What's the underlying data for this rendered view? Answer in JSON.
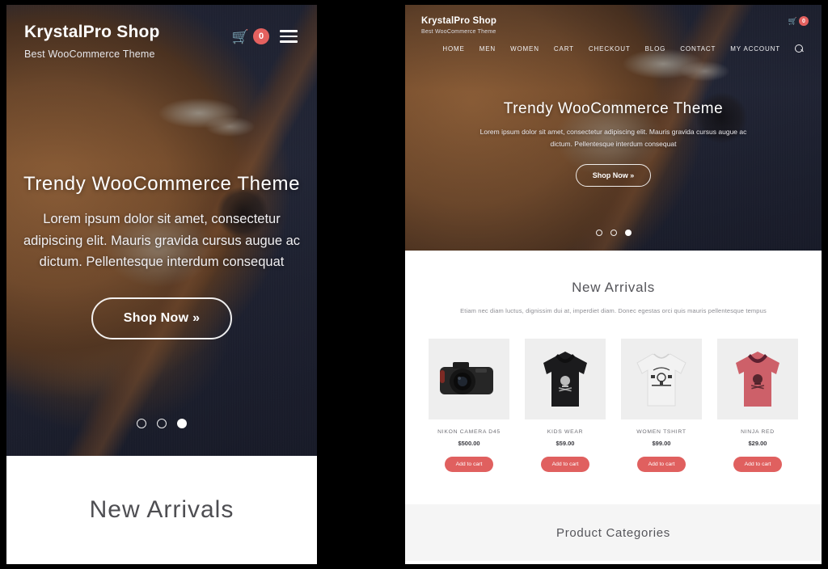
{
  "brand": {
    "title": "KrystalPro Shop",
    "tagline": "Best WooCommerce Theme"
  },
  "cart": {
    "count": "0",
    "icon": "shopping-cart-icon"
  },
  "mobile": {
    "menu_icon": "hamburger-menu-icon",
    "hero": {
      "heading": "Trendy WooCommerce Theme",
      "paragraph": "Lorem ipsum dolor sit amet, consectetur adipiscing elit. Mauris gravida cursus augue ac dictum. Pellentesque interdum consequat",
      "cta": "Shop Now »",
      "slides": [
        "1",
        "2",
        "3"
      ],
      "active_slide": 3
    },
    "arrivals_title": "New Arrivals"
  },
  "desktop": {
    "nav": [
      {
        "label": "HOME"
      },
      {
        "label": "MEN"
      },
      {
        "label": "WOMEN"
      },
      {
        "label": "CART"
      },
      {
        "label": "CHECKOUT"
      },
      {
        "label": "BLOG"
      },
      {
        "label": "CONTACT"
      },
      {
        "label": "MY ACCOUNT"
      }
    ],
    "search_icon": "search-icon",
    "hero": {
      "heading": "Trendy WooCommerce Theme",
      "paragraph": "Lorem ipsum dolor sit amet, consectetur adipiscing elit. Mauris gravida cursus augue ac dictum. Pellentesque interdum consequat",
      "cta": "Shop Now »",
      "slides": [
        "1",
        "2",
        "3"
      ],
      "active_slide": 3
    },
    "arrivals": {
      "title": "New Arrivals",
      "subtitle": "Etiam nec diam luctus, dignissim dui at, imperdiet diam. Donec egestas orci quis mauris pellentesque tempus"
    },
    "products": [
      {
        "name": "NIKON CAMERA D45",
        "price": "$500.00",
        "cta": "Add to cart",
        "image": "dslr-camera-photo"
      },
      {
        "name": "KIDS WEAR",
        "price": "$59.00",
        "cta": "Add to cart",
        "image": "black-skull-hoodie-photo"
      },
      {
        "name": "WOMEN TSHIRT",
        "price": "$99.00",
        "cta": "Add to cart",
        "image": "white-graphic-tshirt-photo"
      },
      {
        "name": "NINJA RED",
        "price": "$29.00",
        "cta": "Add to cart",
        "image": "red-hoodie-photo"
      }
    ],
    "categories_title": "Product Categories"
  },
  "colors": {
    "accent": "#e0605f",
    "badge": "#e4615f",
    "hero_navy": "#2b2f42",
    "leather_brown": "#935f34",
    "page_bg": "#000000",
    "panel_bg": "#ffffff",
    "categories_bg": "#f5f5f5"
  }
}
